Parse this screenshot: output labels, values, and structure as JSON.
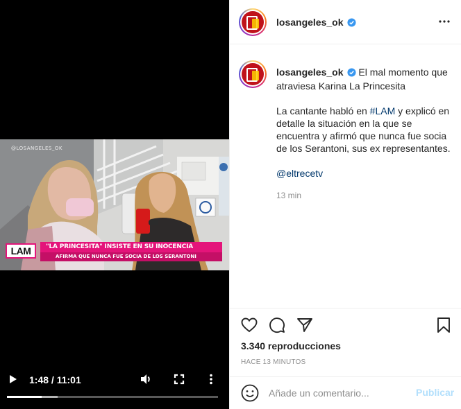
{
  "video": {
    "watermark": "@LOSANGELES_OK",
    "lower_third": {
      "logo": "LAM",
      "headline": "\"LA PRINCESITA\" INSISTE EN SU INOCENCIA",
      "subline": "AFIRMA QUE NUNCA FUE SOCIA DE LOS SERANTONI"
    },
    "controls": {
      "play_icon": "play-icon",
      "time": "1:48 / 11:01",
      "volume_icon": "volume-icon",
      "fullscreen_icon": "fullscreen-icon",
      "more_icon": "more-vertical-icon",
      "progress_fraction": 0.163
    }
  },
  "post": {
    "username": "losangeles_ok",
    "verified": true,
    "more_icon": "more-horizontal-icon",
    "caption": {
      "username": "losangeles_ok",
      "first_line": "El mal momento que atraviesa Karina La Princesita",
      "body_prefix": "La cantante habló en ",
      "hashtag": "#LAM",
      "body_suffix": " y explicó en detalle la situación en la que se encuentra y afirmó que nunca fue socia de los Serantoni, sus ex representantes.",
      "mention": "@eltrecetv",
      "time": "13 min"
    },
    "actions": {
      "like_icon": "heart-icon",
      "comment_icon": "comment-icon",
      "share_icon": "share-icon",
      "save_icon": "bookmark-icon"
    },
    "views": "3.340 reproducciones",
    "age": "HACE 13 MINUTOS",
    "comment_box": {
      "emoji_icon": "emoji-icon",
      "placeholder": "Añade un comentario...",
      "publish_label": "Publicar"
    }
  },
  "colors": {
    "link": "#00376b",
    "publish_disabled": "#b2dffc",
    "verified": "#3897f0",
    "lower_third_pink": "#e4147a"
  }
}
